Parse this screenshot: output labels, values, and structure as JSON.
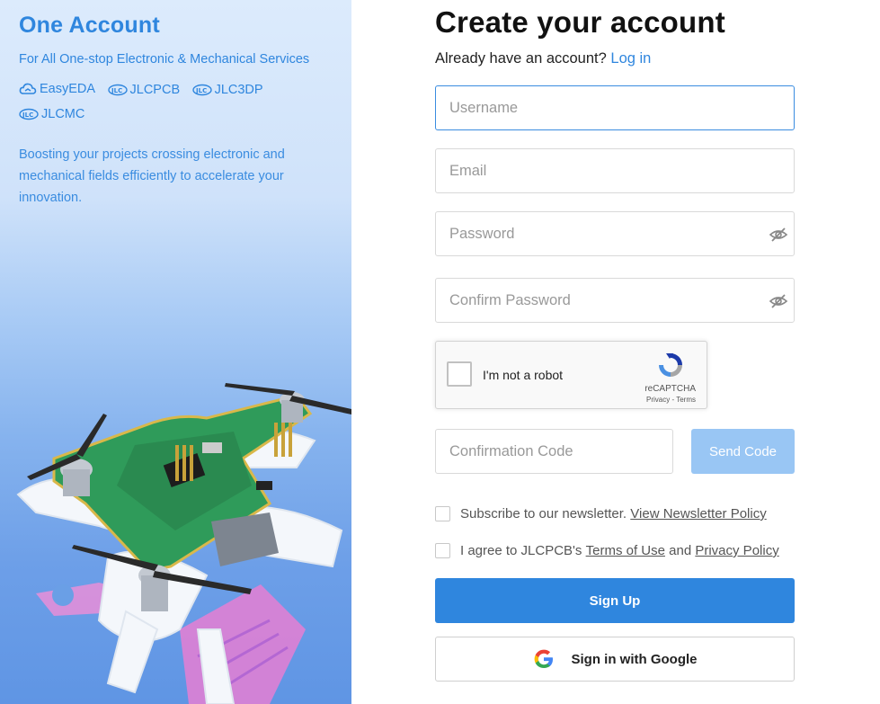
{
  "left": {
    "brand": "One Account",
    "tagline": "For All One-stop Electronic & Mechanical Services",
    "products": [
      "EasyEDA",
      "JLCPCB",
      "JLC3DP",
      "JLCMC"
    ],
    "description": "Boosting your projects crossing electronic and mechanical fields efficiently to accelerate your innovation."
  },
  "form": {
    "title": "Create your account",
    "login_prompt": "Already have an account?",
    "login_link": "Log in",
    "username_placeholder": "Username",
    "email_placeholder": "Email",
    "password_placeholder": "Password",
    "confirm_password_placeholder": "Confirm Password",
    "captcha_label": "I'm not a robot",
    "captcha_brand": "reCAPTCHA",
    "captcha_links": "Privacy - Terms",
    "code_placeholder": "Confirmation Code",
    "send_code_label": "Send Code",
    "newsletter_text": "Subscribe to our newsletter.",
    "newsletter_link": "View Newsletter Policy",
    "agree_text": "I agree to JLCPCB's",
    "terms_link": "Terms of Use",
    "and_text": "and",
    "privacy_link": "Privacy Policy",
    "signup_label": "Sign Up",
    "google_label": "Sign in with Google"
  },
  "colors": {
    "accent": "#2f86de",
    "send_disabled": "#99c6f4"
  },
  "icons": [
    "easyeda-cloud-icon",
    "jlc-logo-icon",
    "eye-slash-icon",
    "recaptcha-icon",
    "google-icon"
  ]
}
